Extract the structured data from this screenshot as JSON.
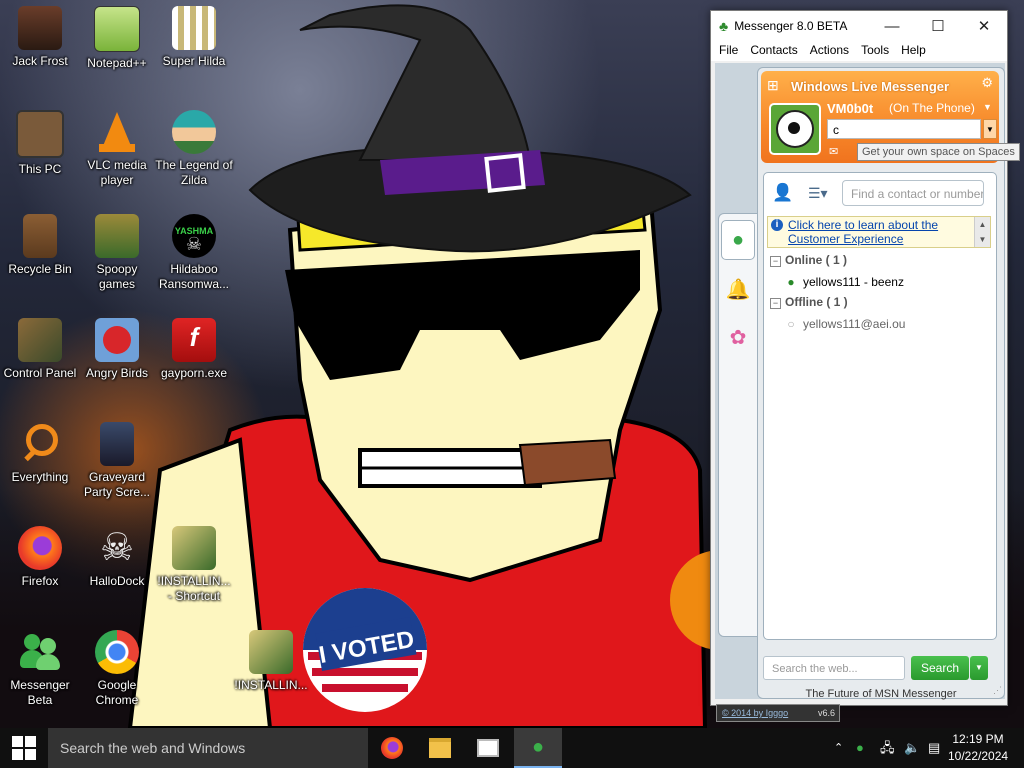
{
  "desktop": {
    "icons": [
      {
        "label": "Jack Frost"
      },
      {
        "label": "Notepad++"
      },
      {
        "label": "Super Hilda"
      },
      {
        "label": "This PC"
      },
      {
        "label": "VLC media player"
      },
      {
        "label": "The Legend of Zilda"
      },
      {
        "label": "Recycle Bin"
      },
      {
        "label": "Spoopy games"
      },
      {
        "label": "Hildaboo Ransomwa..."
      },
      {
        "label": "Control Panel"
      },
      {
        "label": "Angry Birds"
      },
      {
        "label": "gayporn.exe"
      },
      {
        "label": "Everything"
      },
      {
        "label": "Graveyard Party Scre..."
      },
      {
        "label": "Firefox"
      },
      {
        "label": "HalloDock"
      },
      {
        "label": "!INSTALLIN... - Shortcut"
      },
      {
        "label": "!INSTALLIN..."
      },
      {
        "label": "Messenger Beta"
      },
      {
        "label": "Google Chrome"
      }
    ],
    "wallpaper_text": {
      "yashma": "YASHMA",
      "voted": "I VOTED"
    }
  },
  "messenger": {
    "title": "Messenger 8.0 BETA",
    "menu": [
      "File",
      "Contacts",
      "Actions",
      "Tools",
      "Help"
    ],
    "brand": "Windows Live Messenger",
    "username": "VM0b0t",
    "status": "(On The Phone)",
    "personal_message": "c",
    "tooltip": "Get your own space on Spaces",
    "find_placeholder": "Find a contact or number",
    "banner_link": "Click here to learn about the Customer Experience",
    "groups": {
      "online": "Online ( 1 )",
      "offline": "Offline ( 1 )"
    },
    "contacts": {
      "online": "yellows111 - beenz",
      "offline": "yellows111@aei.ou"
    },
    "search_web_placeholder": "Search the web...",
    "search_button": "Search",
    "footer": "The Future of MSN Messenger",
    "badge_text": "© 2014 by Igggo",
    "badge_version": "v6.6"
  },
  "taskbar": {
    "search_placeholder": "Search the web and Windows",
    "time": "12:19 PM",
    "date": "10/22/2024"
  },
  "colors": {
    "header_orange": "#f7882a",
    "search_green": "#2a9a2e",
    "taskbar": "#101010"
  }
}
